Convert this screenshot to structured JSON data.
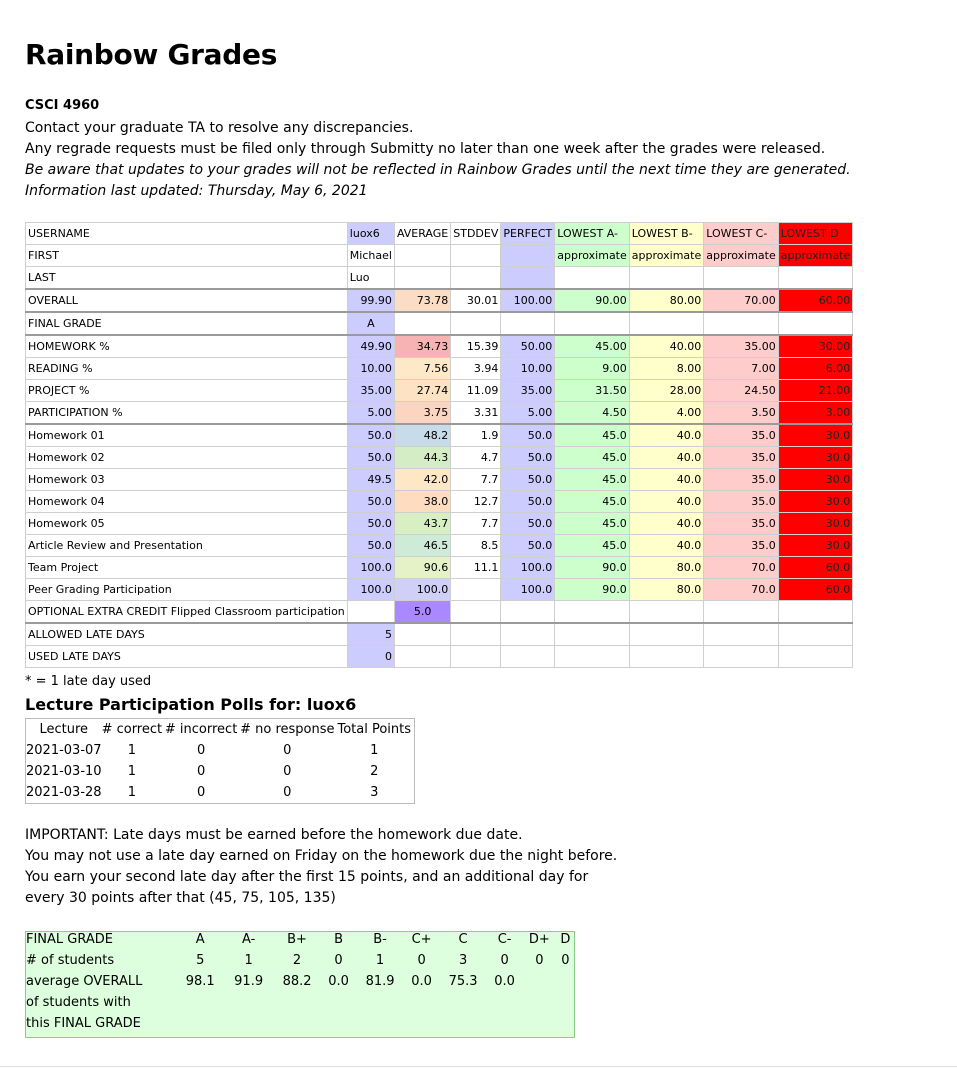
{
  "title": "Rainbow Grades",
  "course": "CSCI 4960",
  "info_lines": [
    "Contact your graduate TA to resolve any discrepancies.",
    "Any regrade requests must be filed only through Submitty no later than one week after the grades were released."
  ],
  "info_italic": [
    "Be aware that updates to your grades will not be reflected in Rainbow Grades until the next time they are generated.",
    "Information last updated: Thursday, May 6, 2021"
  ],
  "grades": {
    "header": [
      "USERNAME",
      "luox6",
      "AVERAGE",
      "STDDEV",
      "PERFECT",
      "LOWEST A-",
      "LOWEST B-",
      "LOWEST C-",
      "LOWEST D"
    ],
    "first": [
      "FIRST",
      "Michael",
      "",
      "",
      "",
      "approximate",
      "approximate",
      "approximate",
      "approximate"
    ],
    "last": [
      "LAST",
      "Luo",
      "",
      "",
      "",
      "",
      "",
      "",
      ""
    ],
    "overall": [
      "OVERALL",
      "99.90",
      "73.78",
      "30.01",
      "100.00",
      "90.00",
      "80.00",
      "70.00",
      "60.00"
    ],
    "final": [
      "FINAL GRADE",
      "A",
      "",
      "",
      "",
      "",
      "",
      "",
      ""
    ],
    "pct_rows": [
      [
        "HOMEWORK %",
        "49.90",
        "34.73",
        "15.39",
        "50.00",
        "45.00",
        "40.00",
        "35.00",
        "30.00"
      ],
      [
        "READING %",
        "10.00",
        "7.56",
        "3.94",
        "10.00",
        "9.00",
        "8.00",
        "7.00",
        "6.00"
      ],
      [
        "PROJECT %",
        "35.00",
        "27.74",
        "11.09",
        "35.00",
        "31.50",
        "28.00",
        "24.50",
        "21.00"
      ],
      [
        "PARTICIPATION %",
        "5.00",
        "3.75",
        "3.31",
        "5.00",
        "4.50",
        "4.00",
        "3.50",
        "3.00"
      ]
    ],
    "item_rows": [
      [
        "Homework 01",
        "50.0",
        "48.2",
        "1.9",
        "50.0",
        "45.0",
        "40.0",
        "35.0",
        "30.0"
      ],
      [
        "Homework 02",
        "50.0",
        "44.3",
        "4.7",
        "50.0",
        "45.0",
        "40.0",
        "35.0",
        "30.0"
      ],
      [
        "Homework 03",
        "49.5",
        "42.0",
        "7.7",
        "50.0",
        "45.0",
        "40.0",
        "35.0",
        "30.0"
      ],
      [
        "Homework 04",
        "50.0",
        "38.0",
        "12.7",
        "50.0",
        "45.0",
        "40.0",
        "35.0",
        "30.0"
      ],
      [
        "Homework 05",
        "50.0",
        "43.7",
        "7.7",
        "50.0",
        "45.0",
        "40.0",
        "35.0",
        "30.0"
      ],
      [
        "Article Review and Presentation",
        "50.0",
        "46.5",
        "8.5",
        "50.0",
        "45.0",
        "40.0",
        "35.0",
        "30.0"
      ],
      [
        "Team Project",
        "100.0",
        "90.6",
        "11.1",
        "100.0",
        "90.0",
        "80.0",
        "70.0",
        "60.0"
      ],
      [
        "Peer Grading Participation",
        "100.0",
        "100.0",
        "",
        "100.0",
        "90.0",
        "80.0",
        "70.0",
        "60.0"
      ],
      [
        "OPTIONAL EXTRA CREDIT Flipped Classroom participation",
        "",
        "5.0",
        "",
        "",
        "",
        "",
        "",
        ""
      ]
    ],
    "item_avg_colors": [
      "#c7dbe8",
      "#d5edc5",
      "#fde7c5",
      "#fddcc0",
      "#d8efc3",
      "#cdebd6",
      "#e5f2c8",
      "#cfcff8",
      "#aa88ff"
    ],
    "pct_avg_colors": [
      "#f7b3b3",
      "#fde8c8",
      "#fde3c4",
      "#fbd5c0"
    ],
    "overall_avg_color": "#fbdcc5",
    "late_rows": [
      [
        "ALLOWED LATE DAYS",
        "5"
      ],
      [
        "USED LATE DAYS",
        "0"
      ]
    ]
  },
  "late_note": "* = 1 late day used",
  "polls": {
    "heading": "Lecture Participation Polls for: luox6",
    "columns": [
      "Lecture",
      "# correct",
      "# incorrect",
      "# no response",
      "Total Points"
    ],
    "rows": [
      [
        "2021-03-07",
        "1",
        "0",
        "0",
        "1"
      ],
      [
        "2021-03-10",
        "1",
        "0",
        "0",
        "2"
      ],
      [
        "2021-03-28",
        "1",
        "0",
        "0",
        "3"
      ]
    ]
  },
  "important_lines": [
    "IMPORTANT: Late days must be earned before the homework due date.",
    "You may not use a late day earned on Friday on the homework due the night before.",
    "You earn your second late day after the first 15 points, and an additional day for",
    "every 30 points after that (45, 75, 105, 135)"
  ],
  "distribution": {
    "labels": [
      "FINAL GRADE",
      "# of students",
      "average OVERALL",
      "of students with",
      "this FINAL GRADE"
    ],
    "grades": [
      "A",
      "A-",
      "B+",
      "B",
      "B-",
      "C+",
      "C",
      "C-",
      "D+",
      "D"
    ],
    "counts": [
      "5",
      "1",
      "2",
      "0",
      "1",
      "0",
      "3",
      "0",
      "0",
      "0"
    ],
    "averages": [
      "98.1",
      "91.9",
      "88.2",
      "0.0",
      "81.9",
      "0.0",
      "75.3",
      "0.0",
      "",
      ""
    ]
  }
}
